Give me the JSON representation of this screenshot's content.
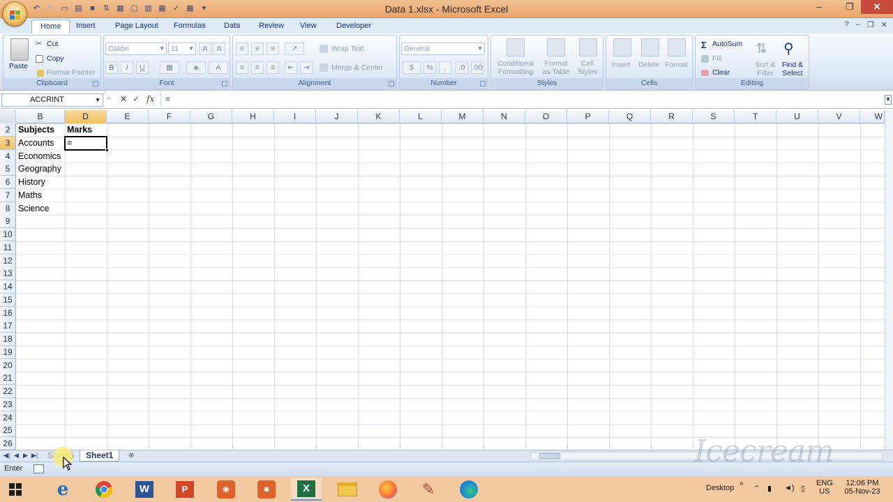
{
  "window": {
    "title": "Data 1.xlsx - Microsoft Excel",
    "controls": [
      "minimize",
      "restore",
      "close"
    ]
  },
  "ribbon_tabs": [
    "Home",
    "Insert",
    "Page Layout",
    "Formulas",
    "Data",
    "Review",
    "View",
    "Developer"
  ],
  "active_tab": "Home",
  "ribbon": {
    "clipboard": {
      "paste": "Paste",
      "cut": "Cut",
      "copy": "Copy",
      "format_painter": "Format Painter",
      "label": "Clipboard"
    },
    "font": {
      "name": "Calibri",
      "size": "11",
      "bold": "B",
      "italic": "I",
      "underline": "U",
      "label": "Font"
    },
    "alignment": {
      "wrap_text": "Wrap Text",
      "merge_center": "Merge & Center",
      "label": "Alignment"
    },
    "number": {
      "format": "General",
      "currency": "$",
      "percent": "%",
      "comma": ",",
      "label": "Number"
    },
    "styles": {
      "conditional": "Conditional",
      "conditional2": "Formatting",
      "format_table": "Format",
      "format_table2": "as Table",
      "cell_styles": "Cell",
      "cell_styles2": "Styles",
      "label": "Styles"
    },
    "cells": {
      "insert": "Insert",
      "delete": "Delete",
      "format": "Format",
      "label": "Cells"
    },
    "editing": {
      "autosum": "AutoSum",
      "fill": "Fill",
      "clear": "Clear",
      "sort_filter": "Sort &",
      "sort_filter2": "Filter",
      "find_select": "Find &",
      "find_select2": "Select",
      "label": "Editing"
    }
  },
  "formula_bar": {
    "name_box": "ACCRINT",
    "cancel": "✕",
    "enter": "✓",
    "fx": "fx",
    "content": "="
  },
  "columns": [
    "B",
    "D",
    "E",
    "F",
    "G",
    "H",
    "I",
    "J",
    "K",
    "L",
    "M",
    "N",
    "O",
    "P",
    "Q",
    "R",
    "S",
    "T",
    "U",
    "V",
    "W"
  ],
  "active_column": "D",
  "rows": [
    "2",
    "3",
    "4",
    "5",
    "6",
    "7",
    "8",
    "9",
    "10",
    "11",
    "12",
    "13",
    "14",
    "15",
    "16",
    "17",
    "18",
    "19",
    "20",
    "21",
    "22",
    "23",
    "24",
    "25",
    "26"
  ],
  "active_row": "3",
  "cells": {
    "B2": "Subjects",
    "D2": "Marks",
    "B3": "Accounts",
    "D3": "=",
    "B4": "Economics",
    "B5": "Geography",
    "B6": "History",
    "B7": "Maths",
    "B8": "Science"
  },
  "sheets": [
    "Sheet5",
    "Sheet1"
  ],
  "active_sheet": "Sheet1",
  "status": {
    "mode": "Enter"
  },
  "taskbar": {
    "apps": [
      "start-icon",
      "edge-legacy-icon",
      "chrome-icon",
      "word-icon",
      "powerpoint-icon",
      "screen-recorder-icon",
      "camera-app-icon",
      "excel-icon",
      "file-explorer-icon",
      "firefox-icon",
      "paint-icon",
      "edge-icon"
    ],
    "desktop_label": "Desktop",
    "lang": "ENG",
    "region": "US",
    "time": "12:06 PM",
    "date": "05-Nov-23"
  },
  "watermark": "Icecream"
}
